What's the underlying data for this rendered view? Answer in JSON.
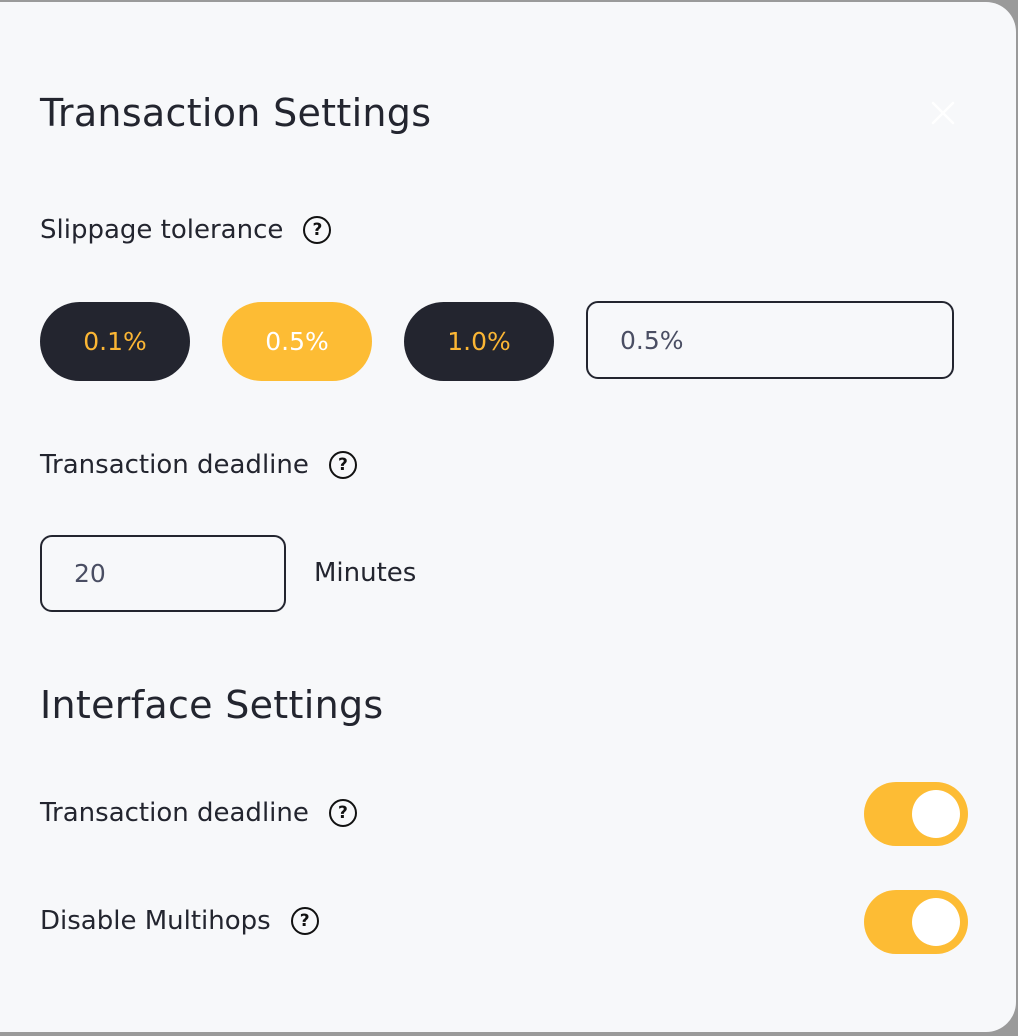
{
  "modal": {
    "title": "Transaction Settings",
    "close_icon": "close-icon"
  },
  "slippage": {
    "label": "Slippage tolerance",
    "help_glyph": "?",
    "options": [
      "0.1%",
      "0.5%",
      "1.0%"
    ],
    "selected": "0.5%",
    "custom_value": "0.5%"
  },
  "deadline": {
    "label": "Transaction deadline",
    "help_glyph": "?",
    "value": "20",
    "unit": "Minutes"
  },
  "interface": {
    "title": "Interface Settings",
    "settings": [
      {
        "label": "Transaction deadline",
        "help_glyph": "?",
        "enabled": true
      },
      {
        "label": "Disable Multihops",
        "help_glyph": "?",
        "enabled": true
      }
    ]
  },
  "colors": {
    "accent": "#fdbc34",
    "dark": "#23252f",
    "background": "#f7f8fa"
  }
}
